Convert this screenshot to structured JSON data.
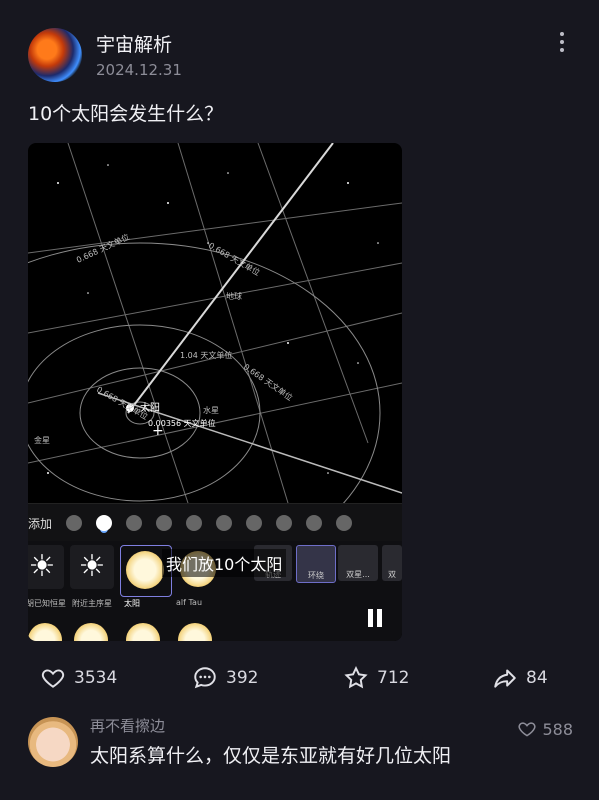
{
  "post": {
    "author": "宇宙解析",
    "date": "2024.12.31",
    "text": "10个太阳会发生什么？"
  },
  "video": {
    "labels": {
      "au1": "0.668 天文单位",
      "au2": "0.668 天文单位",
      "au3": "1.04 天文单位",
      "au4": "0.668 天文单位",
      "au5": "0.668 天文单位",
      "au6": "0.00356 天文单位",
      "earth": "地球",
      "sun": "太阳",
      "mercury": "水星",
      "venus": "金星"
    },
    "toolbar_label": "添加",
    "caption": "我们放10个太阳",
    "tiles": {
      "t1": "胡已知恒星",
      "t2": "附近主序星",
      "t3": "太阳",
      "t4": "alf Tau",
      "b1": "轨迹",
      "b2": "环绕",
      "b3": "双星...",
      "b4": "双"
    }
  },
  "actions": {
    "likes": "3534",
    "comments": "392",
    "favorites": "712",
    "shares": "84"
  },
  "comment": {
    "name": "再不看擦边",
    "text": "太阳系算什么，仅仅是东亚就有好几位太阳",
    "likes": "588"
  }
}
